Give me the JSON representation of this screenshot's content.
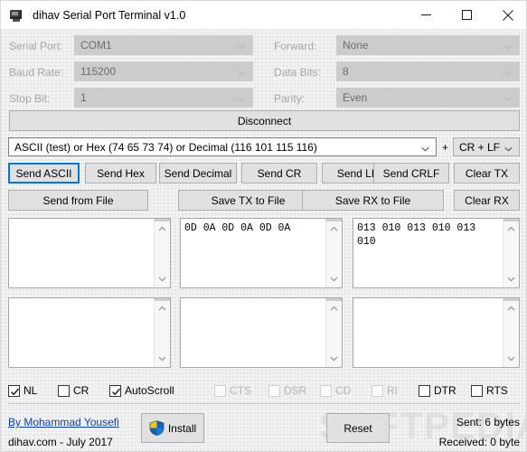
{
  "window": {
    "title": "dihav Serial Port Terminal v1.0",
    "icon": "terminal-monitor-icon",
    "controls": {
      "minimize": "minimize-icon",
      "maximize": "maximize-icon",
      "close": "close-icon"
    }
  },
  "settings": {
    "serial_port": {
      "label": "Serial Port:",
      "value": "COM1",
      "disabled": true
    },
    "baud_rate": {
      "label": "Baud Rate:",
      "value": "115200",
      "disabled": true
    },
    "stop_bit": {
      "label": "Stop Bit:",
      "value": "1",
      "disabled": true
    },
    "forward": {
      "label": "Forward:",
      "value": "None",
      "disabled": true
    },
    "data_bits": {
      "label": "Data Bits:",
      "value": "8",
      "disabled": true
    },
    "parity": {
      "label": "Parity:",
      "value": "Even",
      "disabled": true
    }
  },
  "connect_button": {
    "label": "Disconnect"
  },
  "send_bar": {
    "input_value": "ASCII (test) or Hex (74 65 73 74) or Decimal (116 101 115 116)",
    "plus": "+",
    "line_ending": "CR + LF"
  },
  "buttons": {
    "send_ascii": "Send ASCII",
    "send_hex": "Send Hex",
    "send_decimal": "Send Decimal",
    "send_cr": "Send CR",
    "send_lf": "Send LF",
    "send_crlf": "Send CRLF",
    "clear_tx": "Clear TX",
    "send_from_file": "Send from File",
    "save_tx_to_file": "Save TX to File",
    "save_rx_to_file": "Save RX to File",
    "clear_rx": "Clear RX",
    "install": "Install",
    "reset": "Reset"
  },
  "panes": {
    "tx_ascii": "",
    "tx_hex": "0D 0A 0D 0A 0D 0A",
    "tx_decimal": "013 010 013 010 013 010",
    "rx_ascii": "",
    "rx_hex": "",
    "rx_decimal": ""
  },
  "checkboxes": [
    {
      "name": "nl",
      "label": "NL",
      "checked": true,
      "disabled": false
    },
    {
      "name": "cr",
      "label": "CR",
      "checked": false,
      "disabled": false
    },
    {
      "name": "autoscroll",
      "label": "AutoScroll",
      "checked": true,
      "disabled": false
    },
    {
      "name": "cts",
      "label": "CTS",
      "checked": false,
      "disabled": true
    },
    {
      "name": "dsr",
      "label": "DSR",
      "checked": false,
      "disabled": true
    },
    {
      "name": "cd",
      "label": "CD",
      "checked": false,
      "disabled": true
    },
    {
      "name": "ri",
      "label": "RI",
      "checked": false,
      "disabled": true
    },
    {
      "name": "dtr",
      "label": "DTR",
      "checked": false,
      "disabled": false
    },
    {
      "name": "rts",
      "label": "RTS",
      "checked": false,
      "disabled": false
    }
  ],
  "footer": {
    "author_link": "By Mohammad Yousefi",
    "site_date": "dihav.com - July 2017",
    "sent": "Sent: 6 bytes",
    "received": "Received: 0 byte"
  },
  "watermark": "SOFTPEDIA",
  "colors": {
    "accent": "#0078d7",
    "link": "#0b3fae",
    "button_face": "#e1e1e1",
    "disabled_text": "#a6a6a6",
    "client_bg": "#f2f2f2"
  }
}
